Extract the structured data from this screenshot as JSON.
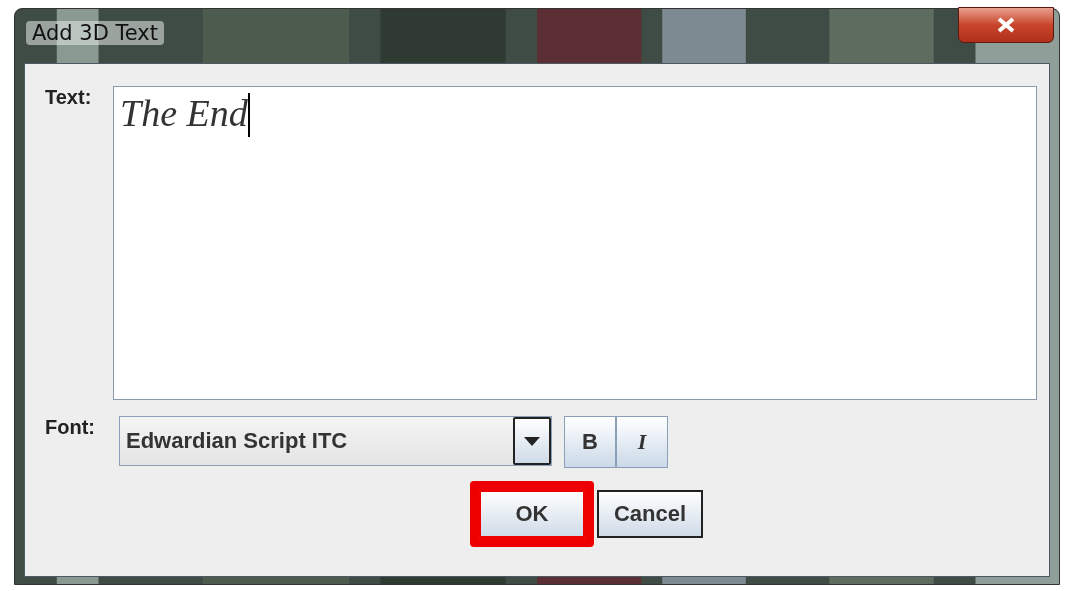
{
  "window": {
    "title": "Add 3D Text"
  },
  "text": {
    "label": "Text:",
    "value": "The End"
  },
  "font": {
    "label": "Font:",
    "value": "Edwardian Script ITC",
    "bold": false,
    "italic": false,
    "bold_label": "B",
    "italic_label": "I"
  },
  "buttons": [
    {
      "label": "OK",
      "highlighted": true
    },
    {
      "label": "Cancel",
      "highlighted": false
    }
  ]
}
